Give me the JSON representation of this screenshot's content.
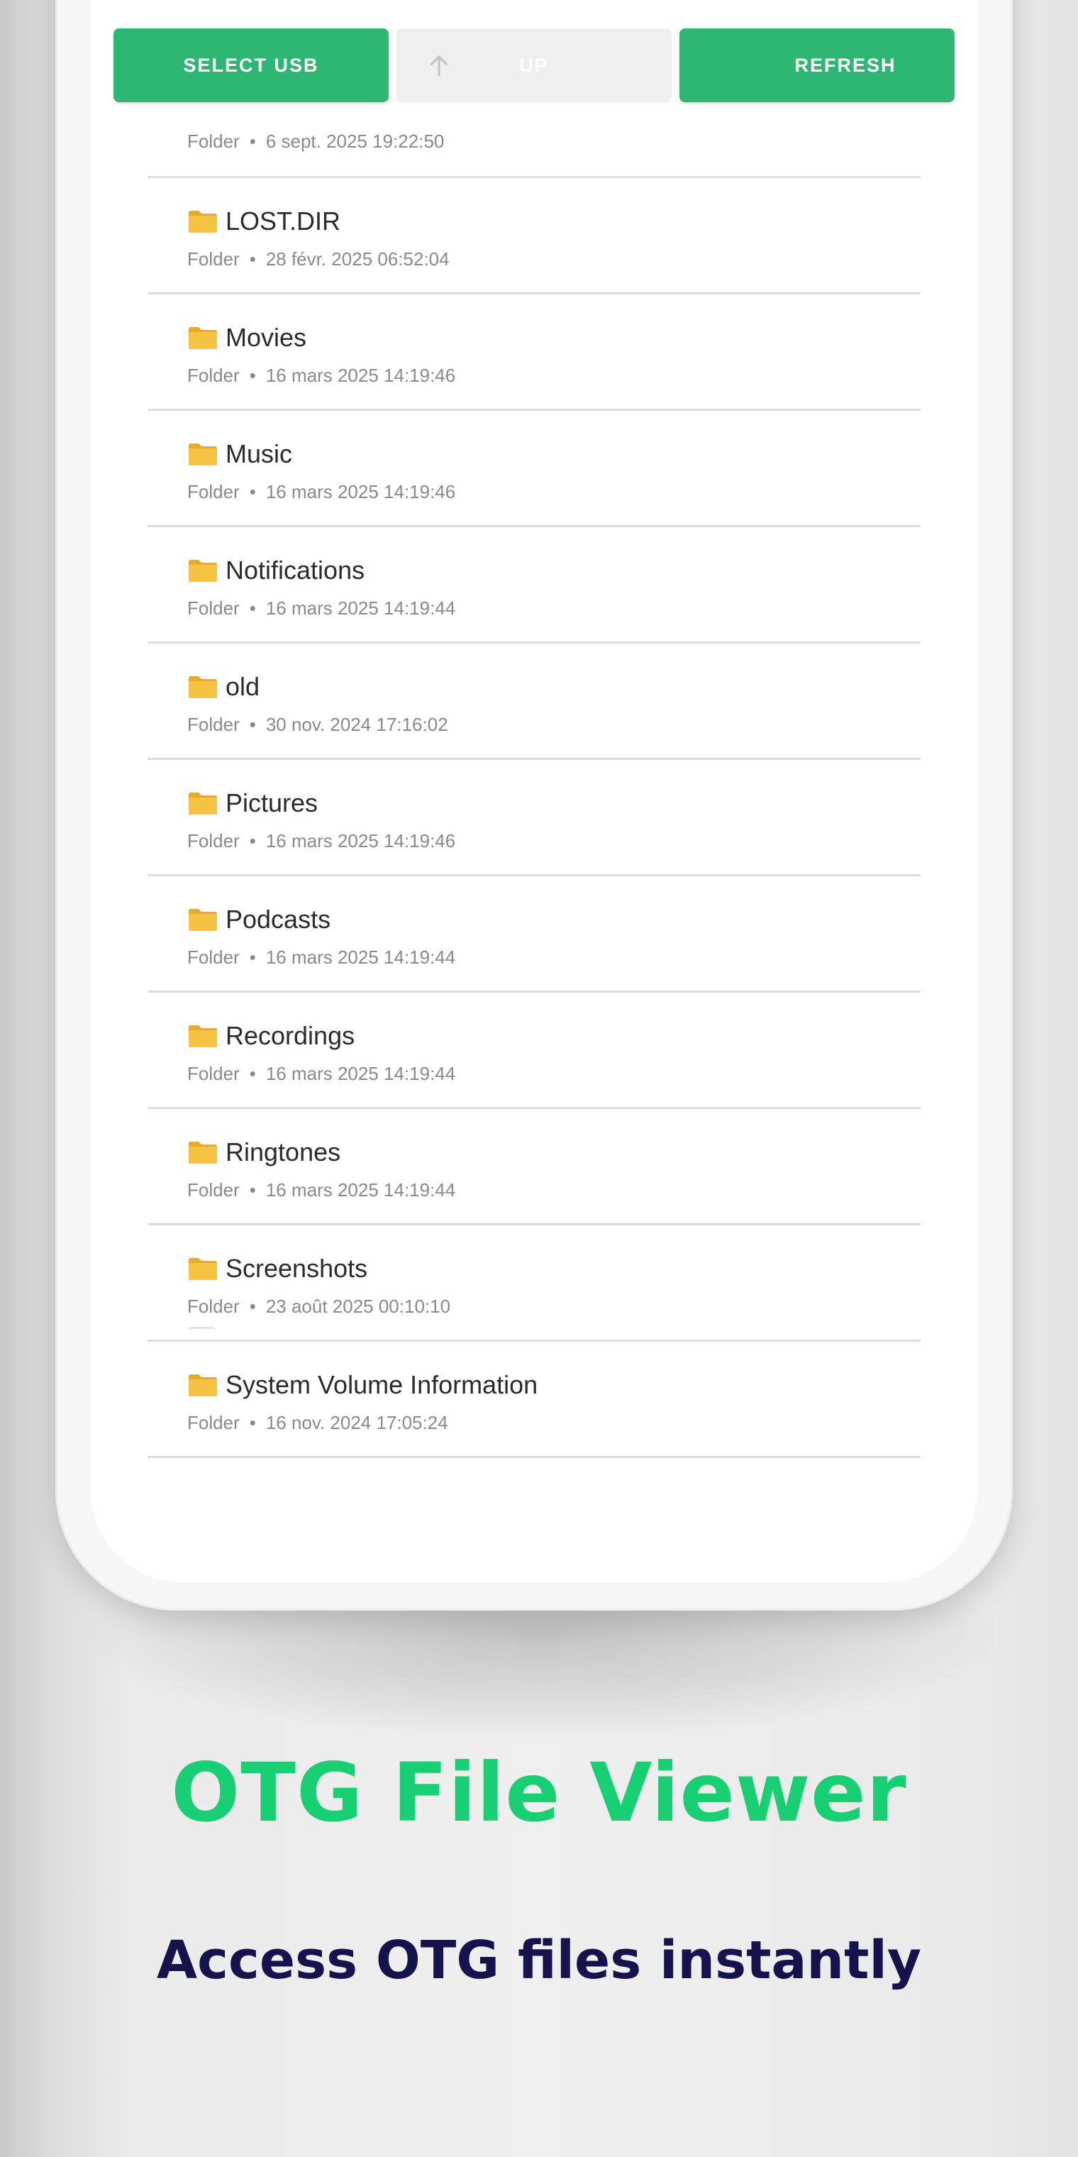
{
  "toolbar": {
    "select_usb_label": "SELECT USB",
    "up_label": "UP",
    "refresh_label": "REFRESH"
  },
  "colors": {
    "accent_green": "#2db773",
    "headline_green": "#19cf74",
    "subline_navy": "#15124d",
    "folder_yellow": "#f6c343"
  },
  "list": {
    "first_meta": {
      "type": "Folder",
      "date": "6 sept. 2025 19:22:50"
    },
    "items": [
      {
        "name": "LOST.DIR",
        "type": "Folder",
        "date": "28 févr. 2025 06:52:04",
        "icon": "folder-icon"
      },
      {
        "name": "Movies",
        "type": "Folder",
        "date": "16 mars 2025 14:19:46",
        "icon": "folder-icon"
      },
      {
        "name": "Music",
        "type": "Folder",
        "date": "16 mars 2025 14:19:46",
        "icon": "folder-icon"
      },
      {
        "name": "Notifications",
        "type": "Folder",
        "date": "16 mars 2025 14:19:44",
        "icon": "folder-icon"
      },
      {
        "name": "old",
        "type": "Folder",
        "date": "30 nov. 2024 17:16:02",
        "icon": "folder-icon"
      },
      {
        "name": "Pictures",
        "type": "Folder",
        "date": "16 mars 2025 14:19:46",
        "icon": "folder-icon"
      },
      {
        "name": "Podcasts",
        "type": "Folder",
        "date": "16 mars 2025 14:19:44",
        "icon": "folder-icon"
      },
      {
        "name": "Recordings",
        "type": "Folder",
        "date": "16 mars 2025 14:19:44",
        "icon": "folder-icon"
      },
      {
        "name": "Ringtones",
        "type": "Folder",
        "date": "16 mars 2025 14:19:44",
        "icon": "folder-icon"
      },
      {
        "name": "Screenshots",
        "type": "Folder",
        "date": "23 août 2025 00:10:10",
        "icon": "folder-icon"
      },
      {
        "name": "System Volume Information",
        "type": "Folder",
        "date": "16 nov. 2024 17:05:24",
        "icon": "folder-icon"
      }
    ]
  },
  "promo": {
    "headline": "OTG File Viewer",
    "subline": "Access OTG files instantly"
  }
}
